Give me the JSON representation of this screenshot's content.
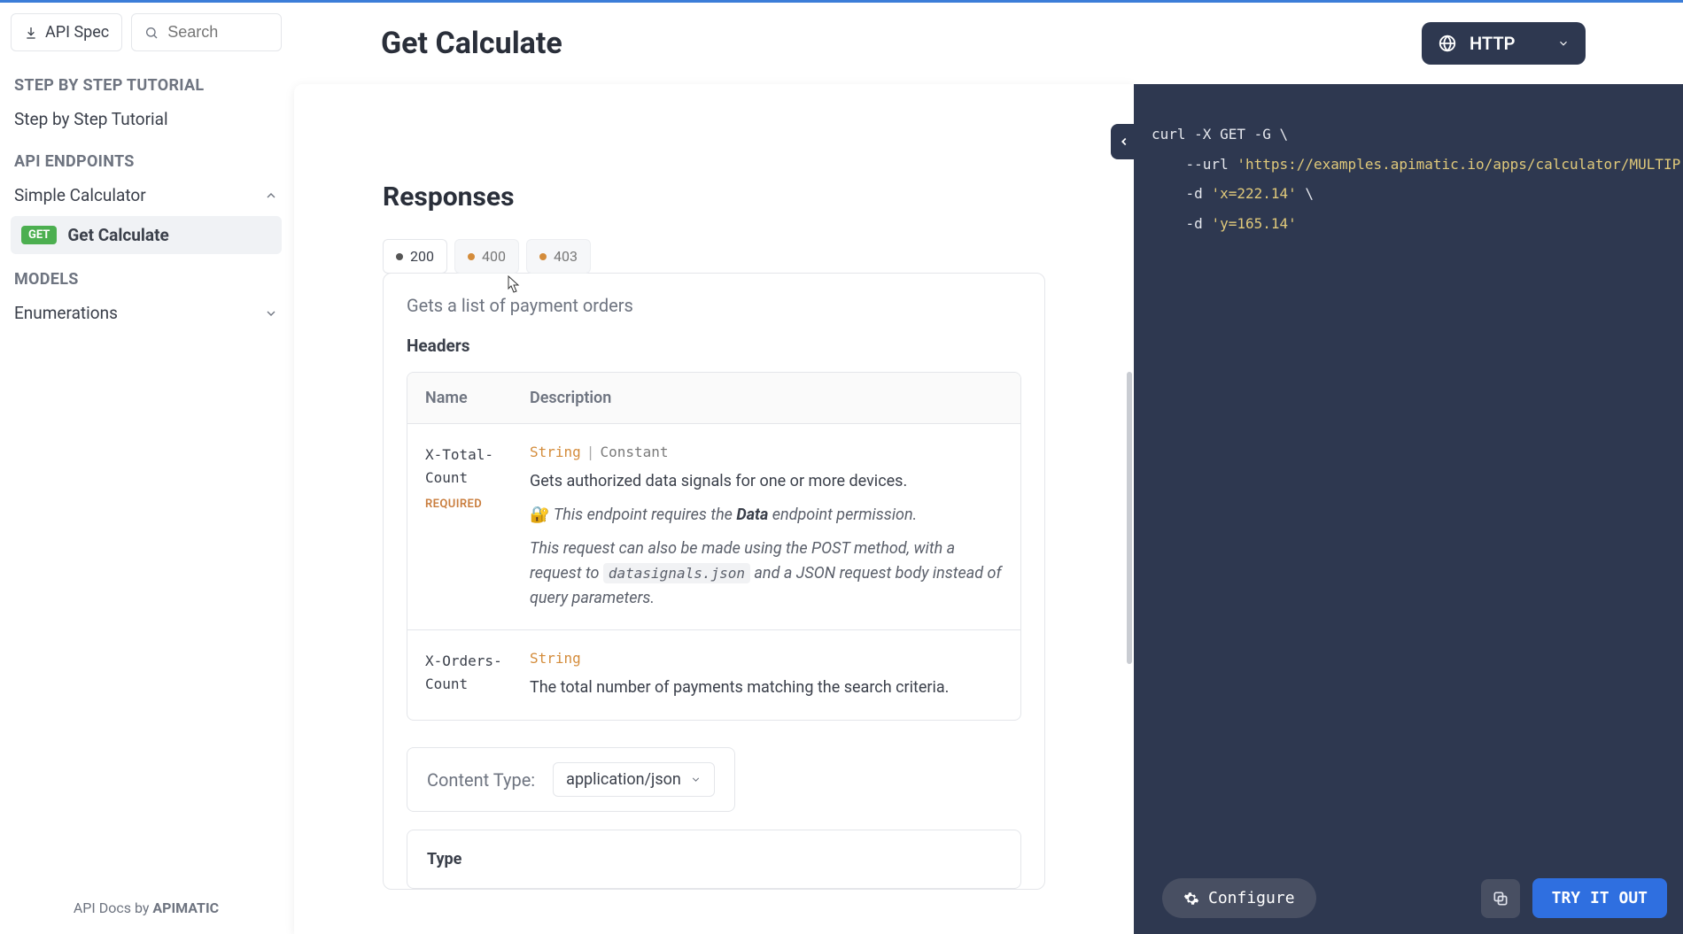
{
  "header": {
    "api_spec_label": "API Spec",
    "search_placeholder": "Search",
    "page_title": "Get Calculate",
    "protocol_label": "HTTP"
  },
  "sidebar": {
    "sections": {
      "tutorial_title": "STEP BY STEP TUTORIAL",
      "tutorial_item": "Step by Step Tutorial",
      "endpoints_title": "API ENDPOINTS",
      "calculator_label": "Simple Calculator",
      "endpoint_method": "GET",
      "endpoint_label": "Get Calculate",
      "models_title": "MODELS",
      "enumerations_label": "Enumerations"
    },
    "footer_prefix": "API Docs by ",
    "footer_brand": "APIMATIC"
  },
  "responses": {
    "title": "Responses",
    "tabs": {
      "t200": "200",
      "t400": "400",
      "t403": "403"
    },
    "description": "Gets a list of payment orders",
    "headers_label": "Headers",
    "table": {
      "col_name": "Name",
      "col_desc": "Description"
    },
    "rows": [
      {
        "name": "X-Total-Count",
        "required": "REQUIRED",
        "type_primary": "String",
        "type_secondary": "Constant",
        "desc_line1": "Gets authorized data signals for one or more devices.",
        "desc_line2_pre": "This endpoint requires the ",
        "desc_line2_bold": "Data",
        "desc_line2_post": " endpoint permission.",
        "desc_line3_pre": "This request can also be made using the POST method, with a request to ",
        "desc_line3_code": "datasignals.json",
        "desc_line3_post": " and a JSON request body instead of query parameters."
      },
      {
        "name": "X-Orders-Count",
        "type_primary": "String",
        "desc_line1": "The total number of payments matching the search criteria."
      }
    ],
    "content_type_label": "Content Type:",
    "content_type_value": "application/json",
    "type_label": "Type"
  },
  "code": {
    "line1_a": "curl -X GET -G ",
    "line1_b": "\\",
    "line2_a": "    --url ",
    "line2_b": "'https://examples.apimatic.io/apps/calculator/MULTIP",
    "line3_a": "    -d ",
    "line3_b": "'x=222.14'",
    "line3_c": " \\",
    "line4_a": "    -d ",
    "line4_b": "'y=165.14'"
  },
  "buttons": {
    "configure": "Configure",
    "try": "TRY IT OUT"
  }
}
